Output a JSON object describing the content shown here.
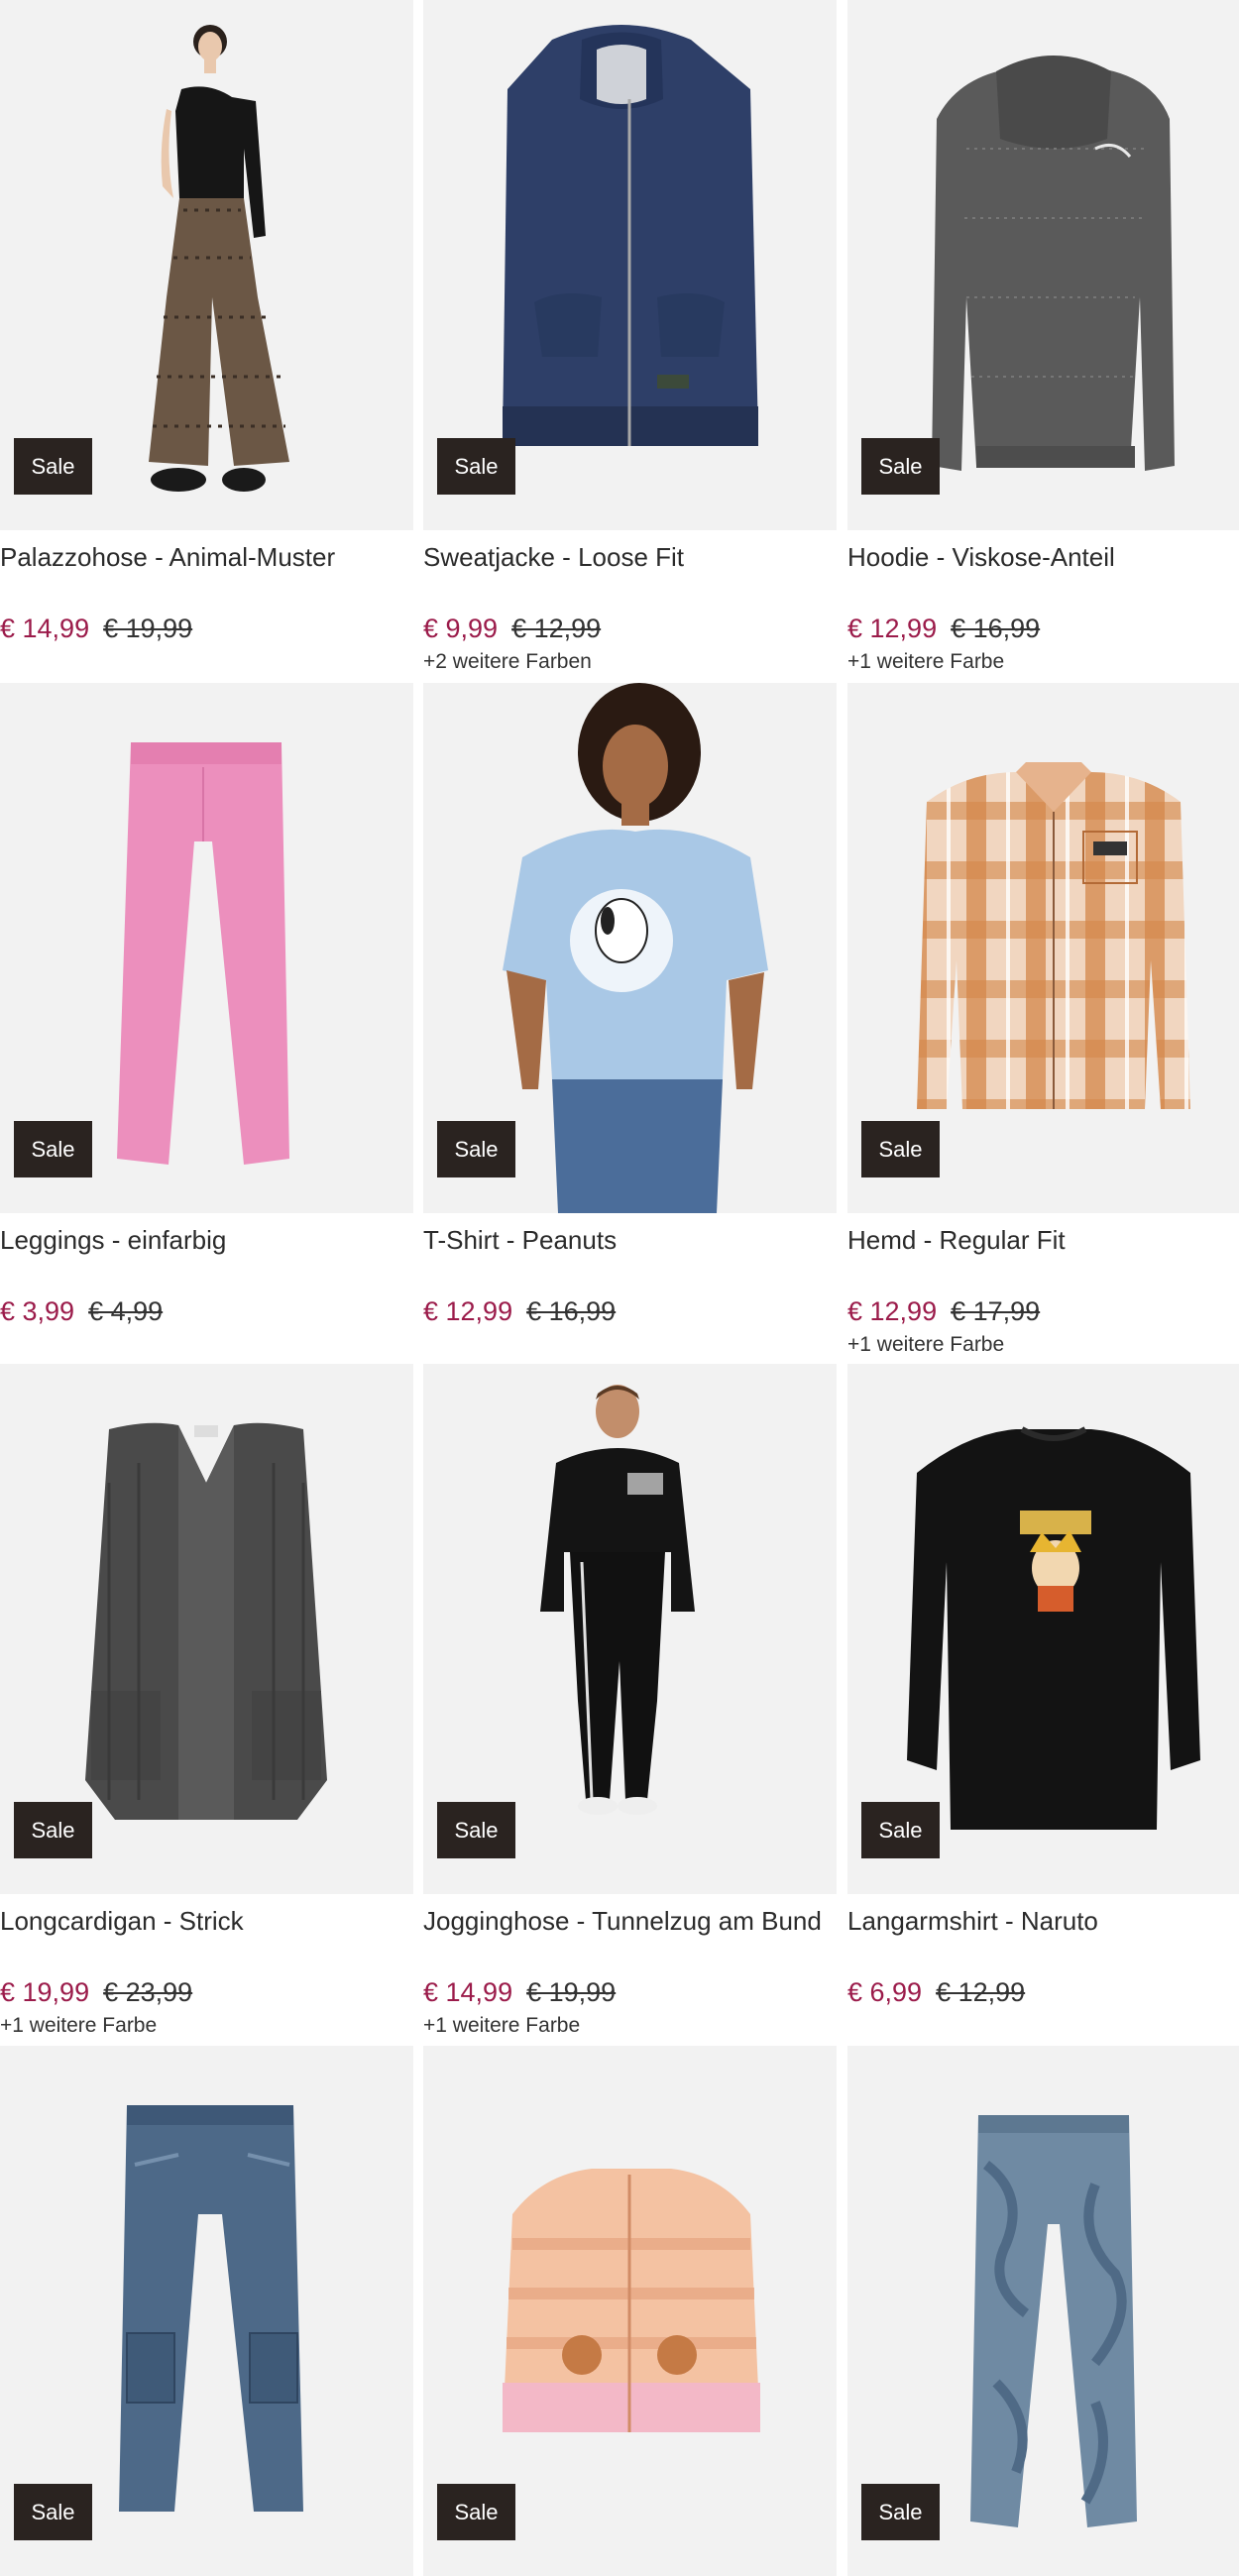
{
  "badge_label": "Sale",
  "products": [
    {
      "title": "Palazzohose - Animal-Muster",
      "sale_price": "€ 14,99",
      "old_price": "€ 19,99",
      "colors": "",
      "image": "palazzo-pants-model"
    },
    {
      "title": "Sweatjacke - Loose Fit",
      "sale_price": "€ 9,99",
      "old_price": "€ 12,99",
      "colors": "+2 weitere Farben",
      "image": "navy-zip-hoodie"
    },
    {
      "title": "Hoodie - Viskose-Anteil",
      "sale_price": "€ 12,99",
      "old_price": "€ 16,99",
      "colors": "+1 weitere Farbe",
      "image": "grey-hoodie"
    },
    {
      "title": "Leggings - einfarbig",
      "sale_price": "€ 3,99",
      "old_price": "€ 4,99",
      "colors": "",
      "image": "pink-leggings"
    },
    {
      "title": "T-Shirt - Peanuts",
      "sale_price": "€ 12,99",
      "old_price": "€ 16,99",
      "colors": "",
      "image": "snoopy-tshirt-model"
    },
    {
      "title": "Hemd - Regular Fit",
      "sale_price": "€ 12,99",
      "old_price": "€ 17,99",
      "colors": "+1 weitere Farbe",
      "image": "plaid-shirt"
    },
    {
      "title": "Longcardigan - Strick",
      "sale_price": "€ 19,99",
      "old_price": "€ 23,99",
      "colors": "+1 weitere Farbe",
      "image": "grey-long-cardigan"
    },
    {
      "title": "Jogginghose - Tunnelzug am Bund",
      "sale_price": "€ 14,99",
      "old_price": "€ 19,99",
      "colors": "+1 weitere Farbe",
      "image": "black-tracksuit-model"
    },
    {
      "title": "Langarmshirt - Naruto",
      "sale_price": "€ 6,99",
      "old_price": "€ 12,99",
      "colors": "",
      "image": "naruto-longsleeve"
    },
    {
      "title": "",
      "sale_price": "",
      "old_price": "",
      "colors": "",
      "image": "cargo-jeans"
    },
    {
      "title": "",
      "sale_price": "",
      "old_price": "",
      "colors": "",
      "image": "deer-cardigan"
    },
    {
      "title": "",
      "sale_price": "",
      "old_price": "",
      "colors": "",
      "image": "marble-joggers"
    }
  ]
}
